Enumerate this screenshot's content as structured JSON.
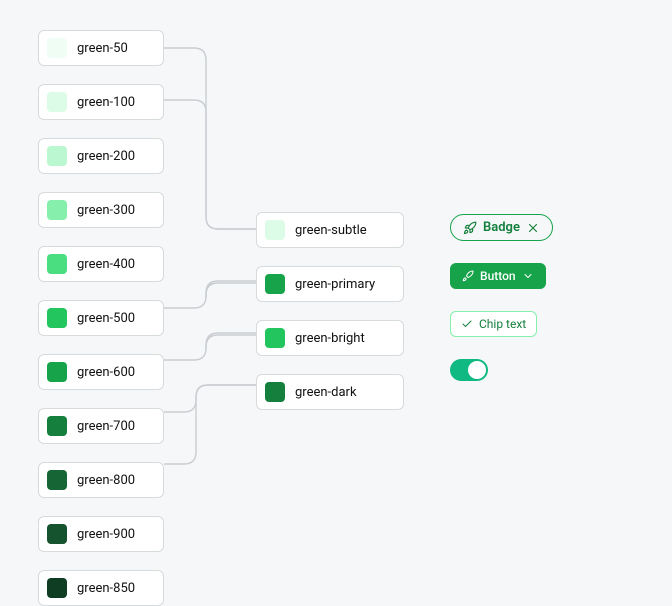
{
  "palette": [
    {
      "name": "green-50",
      "hex": "#f0fdf4"
    },
    {
      "name": "green-100",
      "hex": "#dcfce7"
    },
    {
      "name": "green-200",
      "hex": "#bbf7d0"
    },
    {
      "name": "green-300",
      "hex": "#86efac"
    },
    {
      "name": "green-400",
      "hex": "#4ade80"
    },
    {
      "name": "green-500",
      "hex": "#22c55e"
    },
    {
      "name": "green-600",
      "hex": "#16a34a"
    },
    {
      "name": "green-700",
      "hex": "#15803d"
    },
    {
      "name": "green-800",
      "hex": "#166534"
    },
    {
      "name": "green-900",
      "hex": "#14532d"
    },
    {
      "name": "green-850",
      "hex": "#0f3d24"
    }
  ],
  "semantic": [
    {
      "name": "green-subtle",
      "hex": "#dcfce7"
    },
    {
      "name": "green-primary",
      "hex": "#16a34a"
    },
    {
      "name": "green-bright",
      "hex": "#22c55e"
    },
    {
      "name": "green-dark",
      "hex": "#15803d"
    }
  ],
  "examples": {
    "badge_label": "Badge",
    "button_label": "Button",
    "chip_label": "Chip text"
  },
  "icons": {
    "rocket": "rocket-icon",
    "close": "close-icon",
    "chevron_down": "chevron-down-icon",
    "check": "check-icon"
  }
}
